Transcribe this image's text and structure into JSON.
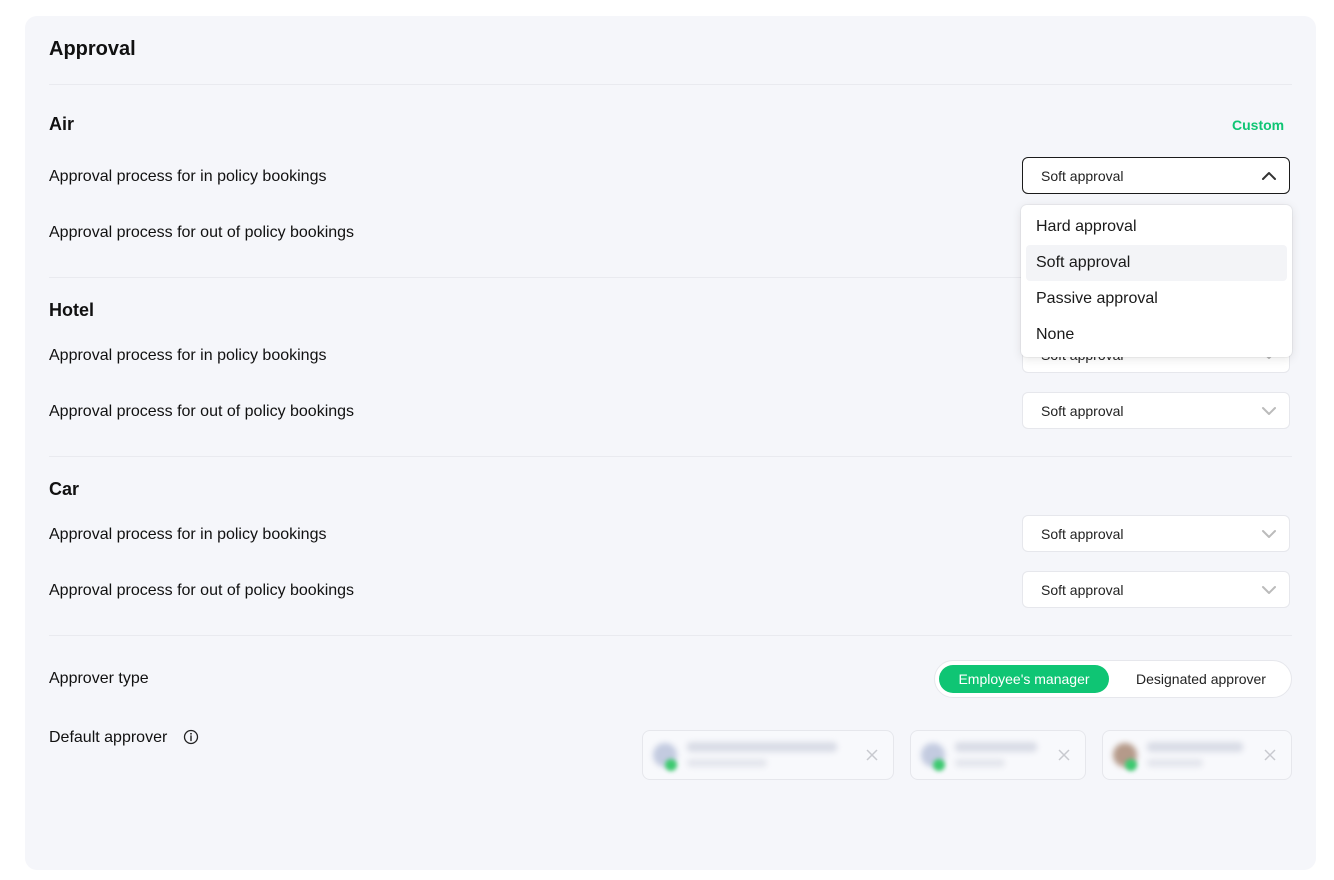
{
  "page": {
    "title": "Approval"
  },
  "sections": {
    "air": {
      "title": "Air",
      "badge": "Custom",
      "rows": [
        {
          "label": "Approval process for in policy bookings",
          "value": "Soft approval"
        },
        {
          "label": "Approval process for out of policy bookings",
          "value": ""
        }
      ]
    },
    "hotel": {
      "title": "Hotel",
      "rows": [
        {
          "label": "Approval process for in policy bookings",
          "value": "Soft approval"
        },
        {
          "label": "Approval process for out of policy bookings",
          "value": "Soft approval"
        }
      ]
    },
    "car": {
      "title": "Car",
      "rows": [
        {
          "label": "Approval process for in policy bookings",
          "value": "Soft approval"
        },
        {
          "label": "Approval process for out of policy bookings",
          "value": "Soft approval"
        }
      ]
    }
  },
  "dropdown": {
    "options": [
      "Hard approval",
      "Soft approval",
      "Passive approval",
      "None"
    ],
    "selected": "Soft approval"
  },
  "approver_type": {
    "label": "Approver type",
    "options": [
      "Employee's manager",
      "Designated approver"
    ],
    "active": "Employee's manager"
  },
  "default_approver": {
    "label": "Default approver",
    "chips": 3
  },
  "colors": {
    "accent": "#0fc574",
    "card_bg": "#f5f6fa",
    "border": "#e6e7ec"
  }
}
